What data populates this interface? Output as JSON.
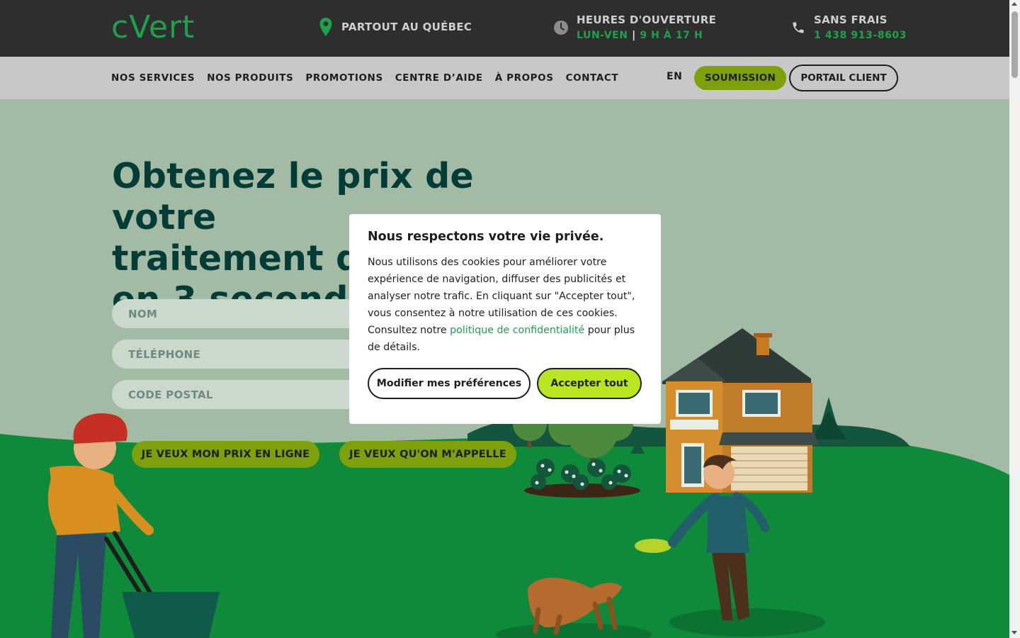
{
  "brand": {
    "logo_text": "cVert",
    "accent_green": "#1fa04c",
    "lime": "#b9e620",
    "dark": "#2e2e2e",
    "title_color": "#033c36"
  },
  "topbar": {
    "location": {
      "icon": "map-pin-icon",
      "label": "PARTOUT AU QUÉBEC"
    },
    "hours": {
      "icon": "clock-icon",
      "title": "HEURES D'OUVERTURE",
      "days": "LUN-VEN",
      "separator": "|",
      "time": "9 H À 17 H"
    },
    "phone": {
      "icon": "phone-icon",
      "title": "SANS FRAIS",
      "number": "1 438 913-8603"
    }
  },
  "nav": {
    "links": [
      "NOS SERVICES",
      "NOS PRODUITS",
      "PROMOTIONS",
      "CENTRE D’AIDE",
      "À PROPOS",
      "CONTACT"
    ],
    "lang": "EN",
    "submit_label": "SOUMISSION",
    "portal_label": "PORTAIL CLIENT"
  },
  "hero": {
    "title_line1": "Obtenez le prix de votre",
    "title_line2": "traitement de pelouse",
    "title_line3": "en 3 secondes",
    "fields": {
      "name": "NOM",
      "phone": "TÉLÉPHONE",
      "postal": "CODE POSTAL"
    },
    "cta_online": "JE VEUX MON PRIX EN LIGNE",
    "cta_call": "JE VEUX QU'ON M'APPELLE"
  },
  "cookie": {
    "title": "Nous respectons votre vie privée.",
    "text_before": "Nous utilisons des cookies pour améliorer votre expérience de navigation, diffuser des publicités et analyser notre trafic. En cliquant sur \"Accepter tout\", vous consentez à notre utilisation de ces cookies. Consultez notre ",
    "link": "politique de confidentialité",
    "text_after": " pour plus de détails.",
    "btn_prefs": "Modifier mes préférences",
    "btn_accept": "Accepter tout"
  }
}
